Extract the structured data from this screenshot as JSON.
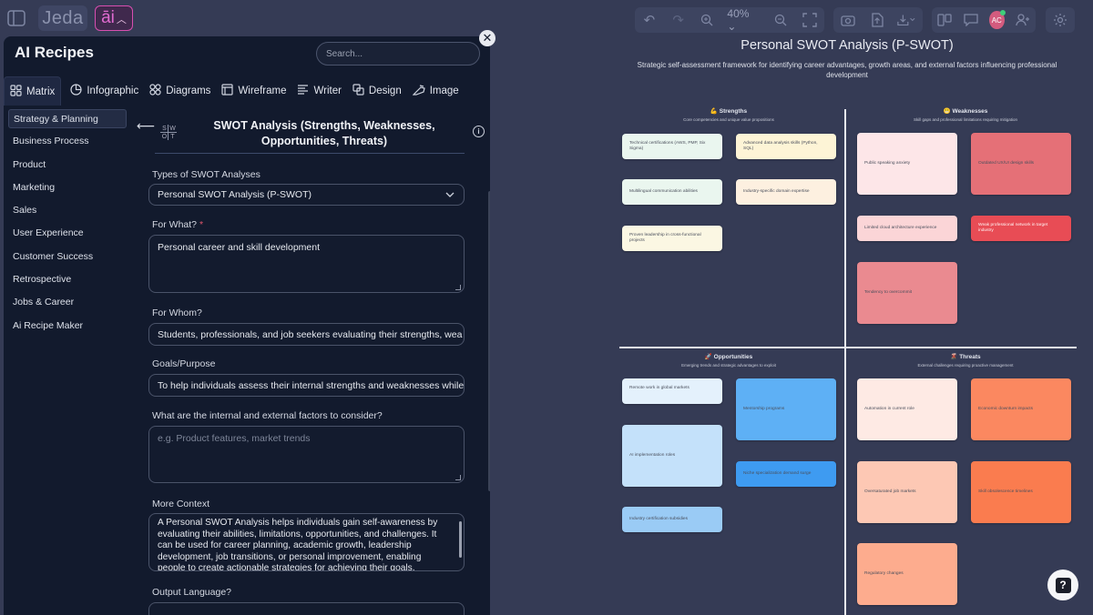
{
  "toolbar": {
    "logo": "Jeda",
    "ai_label": "āi",
    "zoom": "40%",
    "avatar_initials": "AC",
    "icons": [
      "sidebar-toggle-icon",
      "undo-icon",
      "redo-icon",
      "zoom-in-icon",
      "zoom-out-icon",
      "fit-screen-icon",
      "camera-icon",
      "upload-icon",
      "download-icon",
      "presentation-icon",
      "comment-icon",
      "add-user-icon",
      "settings-icon"
    ]
  },
  "panel": {
    "title": "AI Recipes",
    "search_placeholder": "Search...",
    "tabs": [
      {
        "label": "Matrix",
        "icon": "grid-icon"
      },
      {
        "label": "Infographic",
        "icon": "pie-icon"
      },
      {
        "label": "Diagrams",
        "icon": "diagram-icon"
      },
      {
        "label": "Wireframe",
        "icon": "wireframe-icon"
      },
      {
        "label": "Writer",
        "icon": "writer-icon"
      },
      {
        "label": "Design",
        "icon": "design-icon"
      },
      {
        "label": "Image",
        "icon": "image-icon"
      }
    ],
    "categories": [
      "Strategy & Planning",
      "Business Process",
      "Product",
      "Marketing",
      "Sales",
      "User Experience",
      "Customer Success",
      "Retrospective",
      "Jobs & Career",
      "Ai Recipe Maker"
    ],
    "form": {
      "title": "SWOT Analysis (Strengths, Weaknesses, Opportunities, Threats)",
      "swot_letters": [
        "S",
        "W",
        "O",
        "T"
      ],
      "types_label": "Types of SWOT Analyses",
      "types_value": "Personal SWOT Analysis (P-SWOT)",
      "for_what_label": "For What?",
      "for_what_value": "Personal career and skill development",
      "for_whom_label": "For Whom?",
      "for_whom_value": "Students, professionals, and job seekers evaluating their strengths, wea",
      "goals_label": "Goals/Purpose",
      "goals_value": "To help individuals assess their internal strengths and weaknesses while",
      "factors_label": "What are the internal and external factors to consider?",
      "factors_placeholder": "e.g. Product features, market trends",
      "context_label": "More Context",
      "context_value": "A Personal SWOT Analysis helps individuals gain self-awareness by evaluating their abilities, limitations, opportunities, and challenges. It can be used for career planning, academic growth, leadership development, job transitions, or personal improvement, enabling people to create actionable strategies for achieving their goals.",
      "output_language_label": "Output Language?"
    }
  },
  "board": {
    "title": "Personal SWOT Analysis (P-SWOT)",
    "subtitle": "Strategic self-assessment framework for identifying career advantages, growth areas, and external factors influencing professional development",
    "quadrants": {
      "strengths": {
        "title": "💪 Strengths",
        "subtitle": "Core competencies and unique value propositions",
        "notes": [
          "Technical certifications (AWS, PMP, Six Sigma)",
          "Advanced data analysis skills (Python, SQL)",
          "Multilingual communication abilities",
          "Industry-specific domain expertise",
          "Proven leadership in cross-functional projects"
        ]
      },
      "weaknesses": {
        "title": "😬 Weaknesses",
        "subtitle": "Skill gaps and professional limitations requiring mitigation",
        "notes": [
          "Public speaking anxiety",
          "Outdated UX/UI design skills",
          "Limited cloud architecture experience",
          "Weak professional network in target industry",
          "Tendency to overcommit"
        ]
      },
      "opportunities": {
        "title": "🚀 Opportunities",
        "subtitle": "Emerging trends and strategic advantages to exploit",
        "notes": [
          "Remote work in global markets",
          "Mentorship programs",
          "AI implementation roles",
          "Niche specialization demand surge",
          "Industry certification subsidies"
        ]
      },
      "threats": {
        "title": "🌋 Threats",
        "subtitle": "External challenges requiring proactive management",
        "notes": [
          "Automation in current role",
          "Economic downturn impacts",
          "Oversaturated job markets",
          "Skill obsolescence timelines",
          "Regulatory changes"
        ]
      }
    },
    "help_label": "?"
  }
}
